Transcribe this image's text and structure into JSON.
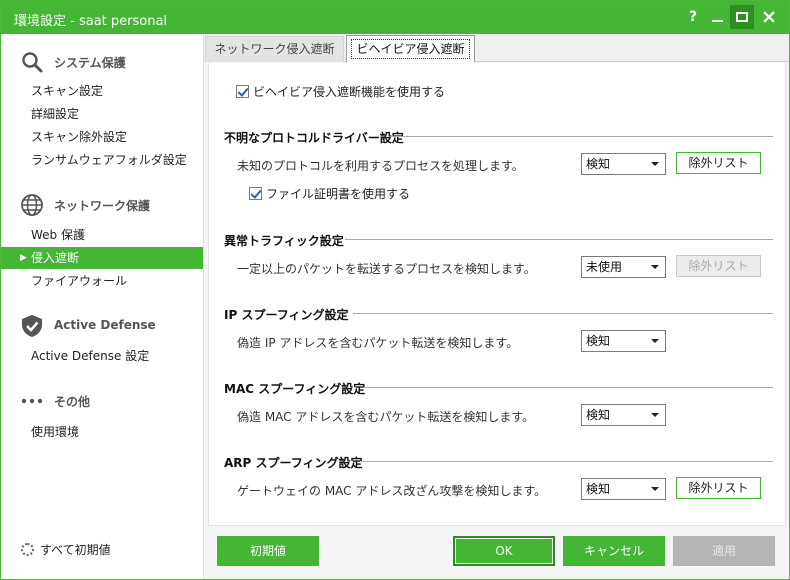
{
  "window": {
    "title": "環境設定 - saat personal",
    "help_glyph": "?",
    "colors": {
      "accent": "#45b535",
      "disabled": "#b5b5b5"
    }
  },
  "sidebar": {
    "sections": [
      {
        "label": "システム保護",
        "icon": "magnifier-icon",
        "items": [
          {
            "label": "スキャン設定"
          },
          {
            "label": "詳細設定"
          },
          {
            "label": "スキャン除外設定"
          },
          {
            "label": "ランサムウェアフォルダ設定"
          }
        ]
      },
      {
        "label": "ネットワーク保護",
        "icon": "globe-icon",
        "items": [
          {
            "label": "Web 保護"
          },
          {
            "label": "侵入遮断",
            "active": true
          },
          {
            "label": "ファイアウォール"
          }
        ]
      },
      {
        "label": "Active Defense",
        "icon": "shield-check-icon",
        "items": [
          {
            "label": "Active Defense 設定"
          }
        ]
      },
      {
        "label": "その他",
        "icon": "more-dots-icon",
        "items": [
          {
            "label": "使用環境"
          }
        ]
      }
    ],
    "reset_all": "すべて初期値"
  },
  "tabs": [
    {
      "label": "ネットワーク侵入遮断",
      "active": false
    },
    {
      "label": "ビヘイビア侵入遮断",
      "active": true
    }
  ],
  "panel": {
    "enable_label": "ビヘイビア侵入遮断機能を使用する",
    "enable_checked": true,
    "groups": [
      {
        "title": "不明なプロトコルドライバー設定",
        "desc": "未知のプロトコルを利用するプロセスを処理します。",
        "select": "検知",
        "exclude_label": "除外リスト",
        "exclude_enabled": true,
        "sub_check": {
          "label": "ファイル証明書を使用する",
          "checked": true
        }
      },
      {
        "title": "異常トラフィック設定",
        "desc": "一定以上のパケットを転送するプロセスを検知します。",
        "select": "未使用",
        "exclude_label": "除外リスト",
        "exclude_enabled": false
      },
      {
        "title": "IP スプーフィング設定",
        "desc": "偽造 IP アドレスを含むパケット転送を検知します。",
        "select": "検知"
      },
      {
        "title": "MAC スプーフィング設定",
        "desc": "偽造 MAC アドレスを含むパケット転送を検知します。",
        "select": "検知"
      },
      {
        "title": "ARP スプーフィング設定",
        "desc": "ゲートウェイの MAC アドレス改ざん攻撃を検知します。",
        "select": "検知",
        "exclude_label": "除外リスト",
        "exclude_enabled": true
      }
    ]
  },
  "footer": {
    "default_label": "初期値",
    "ok_label": "OK",
    "cancel_label": "キャンセル",
    "apply_label": "適用"
  }
}
